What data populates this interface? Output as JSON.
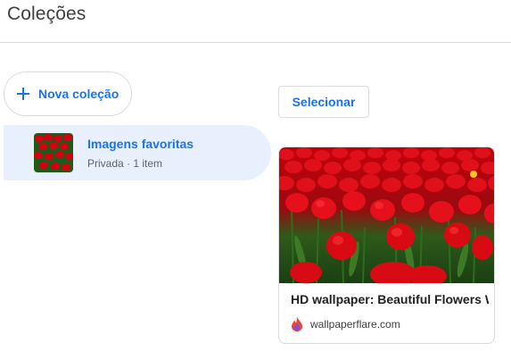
{
  "page": {
    "title": "Coleções"
  },
  "sidebar": {
    "new_collection_label": "Nova coleção",
    "collections": [
      {
        "name": "Imagens favoritas",
        "meta": "Privada · 1 item"
      }
    ]
  },
  "main": {
    "select_label": "Selecionar",
    "items": [
      {
        "title": "HD wallpaper: Beautiful Flowers Wallpaper",
        "source": "wallpaperflare.com"
      }
    ]
  },
  "colors": {
    "accent": "#1a73e8",
    "selected_bg": "#e8f0fe",
    "border": "#dadce0",
    "flower_red": "#d50010",
    "stem_green": "#1f5a1c"
  },
  "icons": {
    "add": "plus-icon",
    "thumbnail": "red-tulips-thumbnail",
    "favicon": "flame-icon"
  }
}
